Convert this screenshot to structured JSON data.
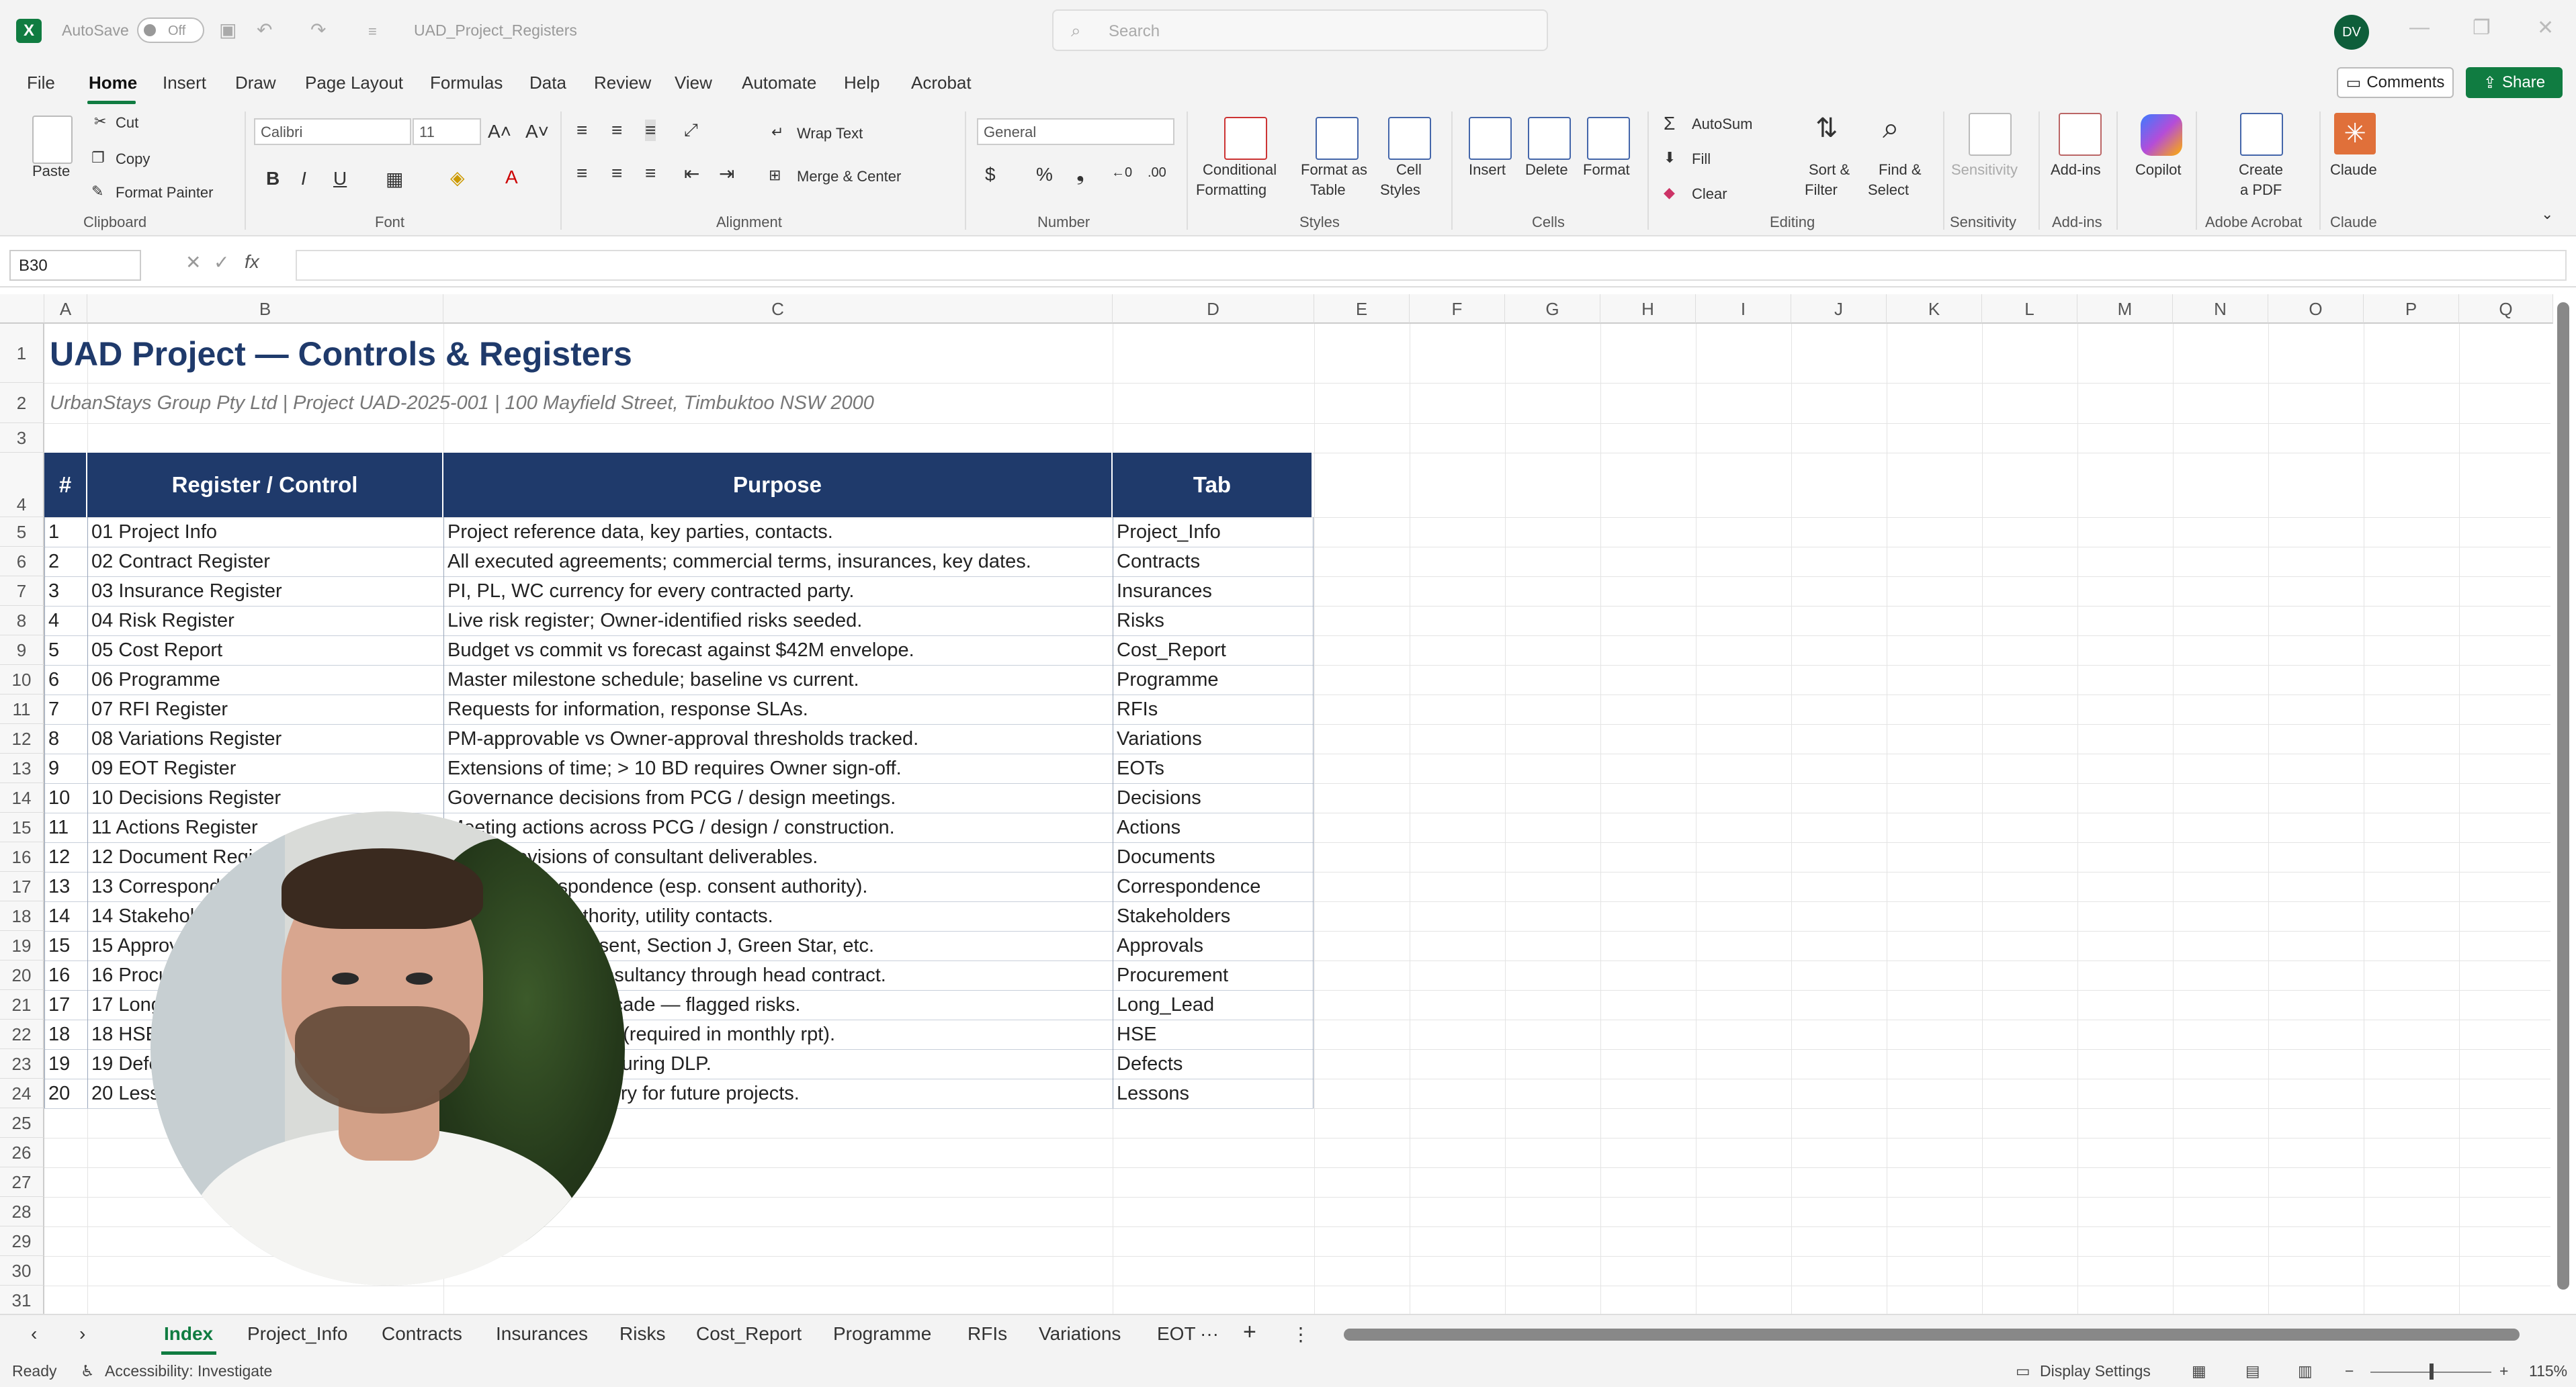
{
  "titlebar": {
    "autosave_label": "AutoSave",
    "autosave_state": "Off",
    "filename": "UAD_Project_Registers",
    "search_placeholder": "Search",
    "user_initials": "DV"
  },
  "menu": {
    "items": [
      "File",
      "Home",
      "Insert",
      "Draw",
      "Page Layout",
      "Formulas",
      "Data",
      "Review",
      "View",
      "Automate",
      "Help",
      "Acrobat"
    ],
    "active": "Home",
    "comments_label": "Comments",
    "share_label": "Share"
  },
  "ribbon": {
    "clipboard": {
      "paste": "Paste",
      "cut": "Cut",
      "copy": "Copy",
      "format_painter": "Format Painter",
      "group": "Clipboard"
    },
    "font": {
      "name": "Calibri",
      "size": "11",
      "group": "Font"
    },
    "alignment": {
      "wrap": "Wrap Text",
      "merge": "Merge & Center",
      "group": "Alignment"
    },
    "number": {
      "format": "General",
      "group": "Number"
    },
    "styles": {
      "conditional": "Conditional",
      "conditional2": "Formatting",
      "format_table": "Format as",
      "format_table2": "Table",
      "cell_styles": "Cell",
      "cell_styles2": "Styles",
      "group": "Styles"
    },
    "cells": {
      "insert": "Insert",
      "delete": "Delete",
      "format": "Format",
      "group": "Cells"
    },
    "editing": {
      "autosum": "AutoSum",
      "fill": "Fill",
      "clear": "Clear",
      "sort": "Sort &",
      "sort2": "Filter",
      "find": "Find &",
      "find2": "Select",
      "group": "Editing"
    },
    "sensitivity": {
      "label": "Sensitivity",
      "group": "Sensitivity"
    },
    "addins": {
      "label": "Add-ins",
      "group": "Add-ins"
    },
    "copilot": {
      "label": "Copilot"
    },
    "acrobat": {
      "label": "Create",
      "label2": "a PDF",
      "group": "Adobe Acrobat"
    },
    "claude": {
      "label": "Claude",
      "group": "Claude"
    }
  },
  "formula_bar": {
    "name_box": "B30",
    "fx": "fx",
    "value": ""
  },
  "columns": [
    "A",
    "B",
    "C",
    "D",
    "E",
    "F",
    "G",
    "H",
    "I",
    "J",
    "K",
    "L",
    "M",
    "N",
    "O",
    "P",
    "Q"
  ],
  "rows": [
    "1",
    "2",
    "3",
    "4",
    "5",
    "6",
    "7",
    "8",
    "9",
    "10",
    "11",
    "12",
    "13",
    "14",
    "15",
    "16",
    "17",
    "18",
    "19",
    "20",
    "21",
    "22",
    "23",
    "24",
    "25",
    "26",
    "27",
    "28",
    "29",
    "30",
    "31"
  ],
  "sheet": {
    "title": "UAD Project — Controls & Registers",
    "subtitle": "UrbanStays Group Pty Ltd  |  Project UAD-2025-001  |  100 Mayfield Street, Timbuktoo NSW 2000",
    "headers": {
      "num": "#",
      "register": "Register / Control",
      "purpose": "Purpose",
      "tab": "Tab"
    },
    "records": [
      {
        "num": "1",
        "register": "01 Project Info",
        "purpose": "Project reference data, key parties, contacts.",
        "tab": "Project_Info"
      },
      {
        "num": "2",
        "register": "02 Contract Register",
        "purpose": "All executed agreements; commercial terms, insurances, key dates.",
        "tab": "Contracts"
      },
      {
        "num": "3",
        "register": "03 Insurance Register",
        "purpose": "PI, PL, WC currency for every contracted party.",
        "tab": "Insurances"
      },
      {
        "num": "4",
        "register": "04 Risk Register",
        "purpose": "Live risk register; Owner-identified risks seeded.",
        "tab": "Risks"
      },
      {
        "num": "5",
        "register": "05 Cost Report",
        "purpose": "Budget vs commit vs forecast against $42M envelope.",
        "tab": "Cost_Report"
      },
      {
        "num": "6",
        "register": "06 Programme",
        "purpose": "Master milestone schedule; baseline vs current.",
        "tab": "Programme"
      },
      {
        "num": "7",
        "register": "07 RFI Register",
        "purpose": "Requests for information, response SLAs.",
        "tab": "RFIs"
      },
      {
        "num": "8",
        "register": "08 Variations Register",
        "purpose": "PM-approvable vs Owner-approval thresholds tracked.",
        "tab": "Variations"
      },
      {
        "num": "9",
        "register": "09 EOT Register",
        "purpose": "Extensions of time; > 10 BD requires Owner sign-off.",
        "tab": "EOTs"
      },
      {
        "num": "10",
        "register": "10 Decisions Register",
        "purpose": "Governance decisions from PCG / design meetings.",
        "tab": "Decisions"
      },
      {
        "num": "11",
        "register": "11 Actions Register",
        "purpose": "Meeting actions across PCG / design / construction.",
        "tab": "Actions"
      },
      {
        "num": "12",
        "register": "12 Document Register",
        "purpose": "Issued revisions of consultant deliverables.",
        "tab": "Documents"
      },
      {
        "num": "13",
        "register": "13 Correspondence",
        "purpose": "Formal correspondence (esp. consent authority).",
        "tab": "Correspondence"
      },
      {
        "num": "14",
        "register": "14 Stakeholders",
        "purpose": "Consultants, authority, utility contacts.",
        "tab": "Stakeholders"
      },
      {
        "num": "15",
        "register": "15 Approvals",
        "purpose": "Development consent, Section J, Green Star, etc.",
        "tab": "Approvals"
      },
      {
        "num": "16",
        "register": "16 Procurement",
        "purpose": "Packages from consultancy through head contract.",
        "tab": "Procurement"
      },
      {
        "num": "17",
        "register": "17 Long Lead",
        "purpose": "Lifts, switchgear, façade — flagged risks.",
        "tab": "Long_Lead"
      },
      {
        "num": "18",
        "register": "18 HSE",
        "purpose": "Safety performance (required in monthly rpt).",
        "tab": "HSE"
      },
      {
        "num": "19",
        "register": "19 Defects",
        "purpose": "Defects at PC and during DLP.",
        "tab": "Defects"
      },
      {
        "num": "20",
        "register": "20 Lessons",
        "purpose": "Lessons from delivery for future projects.",
        "tab": "Lessons"
      }
    ]
  },
  "sheet_tabs": [
    "Index",
    "Project_Info",
    "Contracts",
    "Insurances",
    "Risks",
    "Cost_Report",
    "Programme",
    "RFIs",
    "Variations",
    "EOT"
  ],
  "active_tab": "Index",
  "status": {
    "ready": "Ready",
    "accessibility": "Accessibility: Investigate",
    "display": "Display Settings",
    "zoom": "115%"
  }
}
